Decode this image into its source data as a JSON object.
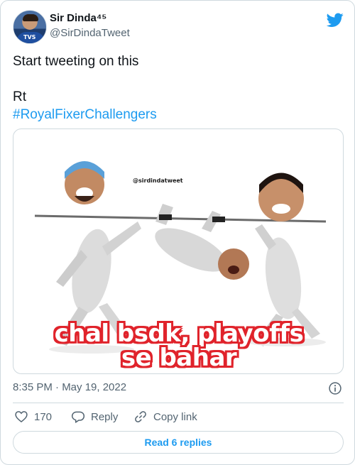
{
  "tweet": {
    "author": {
      "name": "Sir Dinda⁴⁵",
      "handle": "@SirDindaTweet",
      "avatar_logo": "TVS"
    },
    "text_lines": [
      "Start tweeting on this",
      "Rt"
    ],
    "hashtag": "#RoyalFixerChallengers",
    "media": {
      "watermark": "@sirdindatweet",
      "caption_line1": "chal bsdk, playoffs",
      "caption_line2": "se bahar",
      "caption_color": "#e0232b"
    },
    "timestamp": "8:35 PM · May 19, 2022",
    "actions": {
      "like_count": "170",
      "reply_label": "Reply",
      "copy_label": "Copy link"
    },
    "read_replies_label": "Read 6 replies"
  },
  "icons": [
    "twitter-bird-icon",
    "info-icon",
    "heart-icon",
    "reply-bubble-icon",
    "link-icon"
  ],
  "colors": {
    "accent": "#1d9bf0",
    "secondary_text": "#536471",
    "border": "#cfd9de"
  }
}
